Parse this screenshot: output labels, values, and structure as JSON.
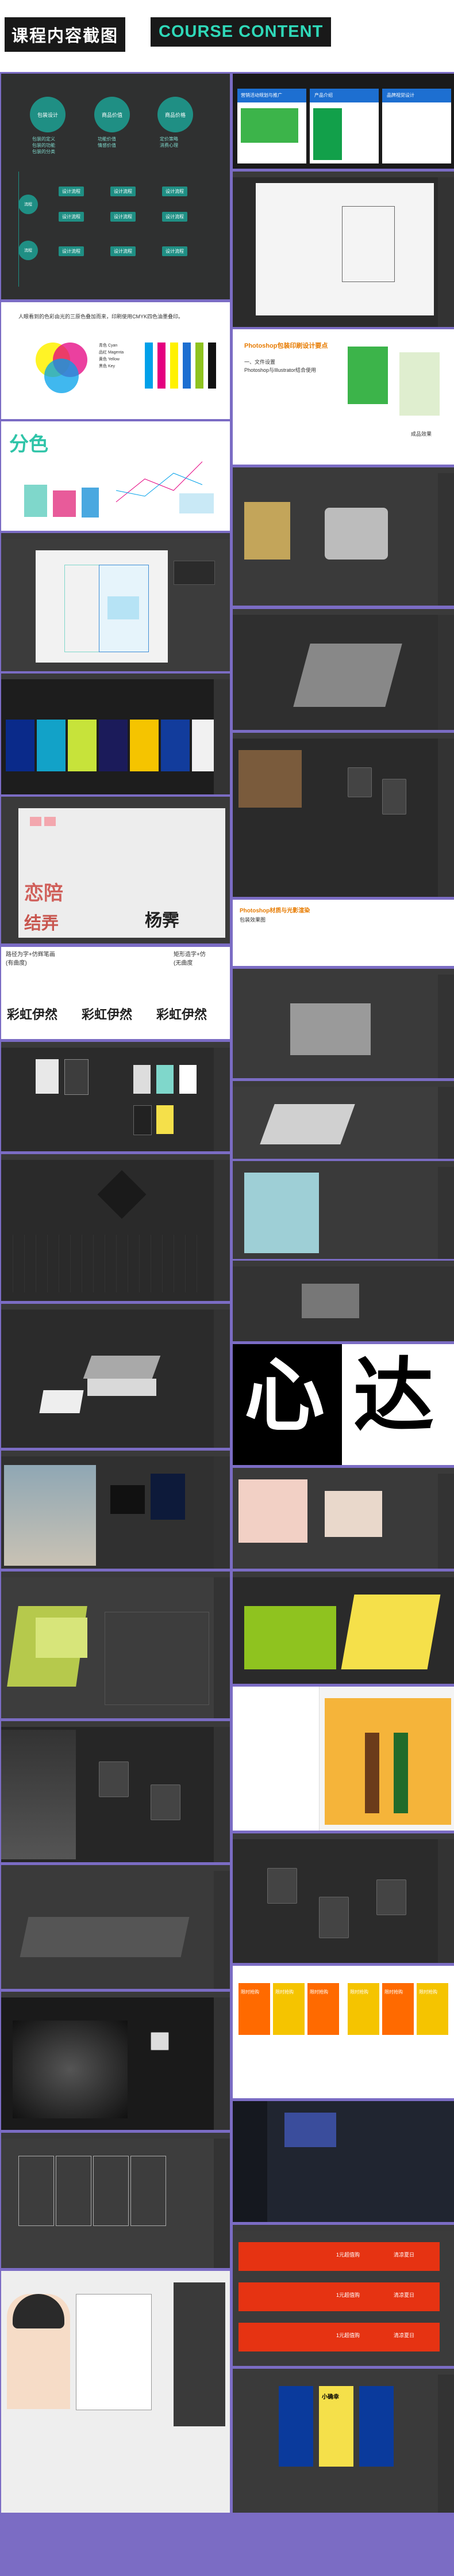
{
  "header": {
    "title_cn": "课程内容截图",
    "title_en": "COURSE CONTENT"
  },
  "left": {
    "p1": {
      "circles": [
        "包装设计",
        "商品价值",
        "商品价格"
      ],
      "circle_notes": [
        "包装的定义\n包装的功能\n包装的分类",
        "功能价值\n情感价值",
        "定价策略\n消费心理"
      ],
      "steps": [
        "设计流程",
        "设计流程",
        "设计流程",
        "设计流程",
        "设计流程",
        "设计流程",
        "设计流程",
        "设计流程",
        "设计流程"
      ]
    },
    "p2": {
      "text": "人眼看到的色彩由光的三原色叠加而来，印刷使用CMYK四色油墨叠印。",
      "legend": [
        "青色 Cyan",
        "品红 Magenta",
        "黄色 Yellow",
        "黑色 Key"
      ]
    },
    "p3": {
      "title": "分色"
    },
    "p6": {
      "chars": [
        "恋陪",
        "结弄",
        "杨霁"
      ]
    },
    "p7": {
      "left_caption": "路径为字+仿辉笔画\n(有曲度)",
      "right_caption": "矩形造字+仿\n(无曲度",
      "words": [
        "彩虹伊然",
        "彩虹伊然",
        "彩虹伊然"
      ]
    }
  },
  "right": {
    "r1": {
      "cards": [
        "营销活动规划与推广",
        "产品介绍",
        "品牌视觉设计"
      ]
    },
    "r3": {
      "heading": "Photoshop包装印刷设计要点",
      "text1": "一、文件设置",
      "text2": "Photoshop与Illustrator结合使用",
      "caption": "成品效果"
    },
    "r7": {
      "heading": "Photoshop材质与光影渲染",
      "subheading": "包装效果图"
    },
    "r12": {
      "chars": [
        "心",
        "达"
      ]
    },
    "r17": {
      "labels": [
        "限时抢购",
        "限时抢购",
        "限时抢购",
        "限时抢购",
        "限时抢购",
        "限时抢购"
      ]
    },
    "r19": {
      "badges": [
        "1元超值购",
        "1元超值购",
        "1元超值购"
      ],
      "tags": [
        "清凉夏日",
        "清凉夏日",
        "清凉夏日"
      ]
    },
    "r20": {
      "card_label": "小确幸"
    }
  },
  "colors": {
    "teal": "#1f8f84",
    "accent_bg": "#7b6cc4",
    "title_en": "#2fd9b9",
    "cyan": "#00a0e9",
    "magenta": "#e4007f",
    "yellow": "#fff100",
    "blue": "#1d6fd1",
    "green_pack": "#8fc31f",
    "orange": "#ff6a00"
  }
}
